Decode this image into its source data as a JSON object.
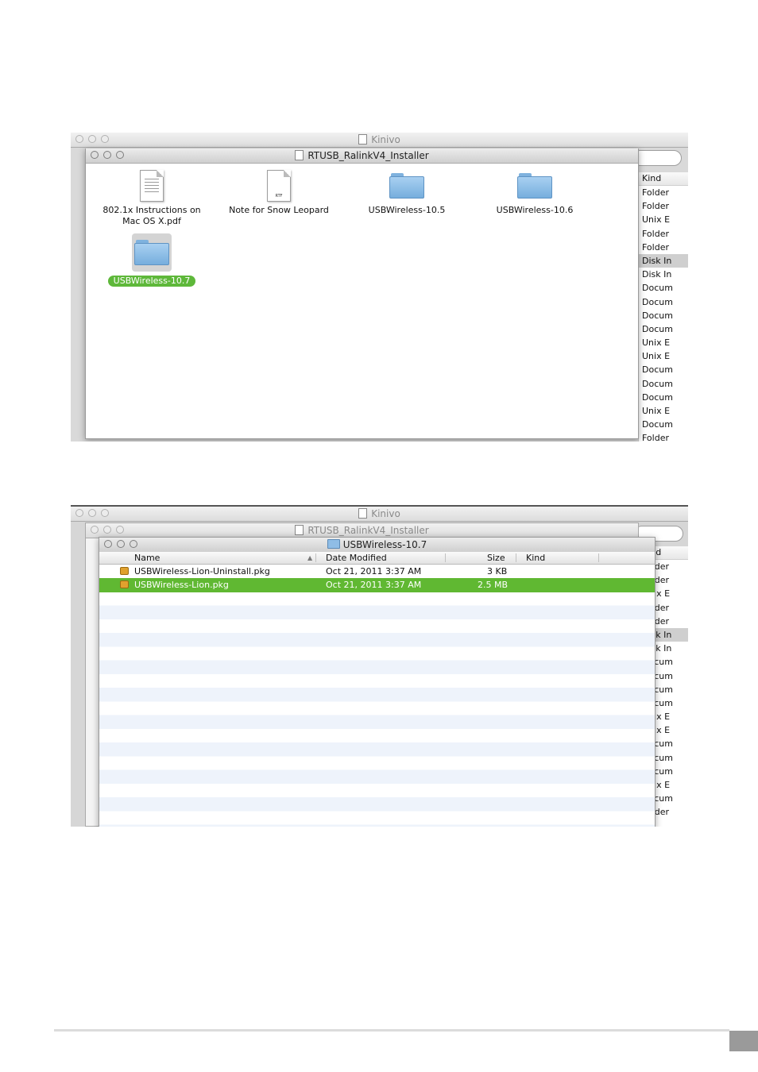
{
  "screenshot1": {
    "back_window_title": "Kinivo",
    "front_window_title": "RTUSB_RalinkV4_Installer",
    "items": [
      {
        "label_line1": "802.1x Instructions on",
        "label_line2": "Mac OS X.pdf",
        "icon": "pdf-document-icon"
      },
      {
        "label_line1": "Note for Snow Leopard",
        "label_line2": "",
        "icon": "rtf-document-icon",
        "badge": "RTF"
      },
      {
        "label_line1": "USBWireless-10.5",
        "label_line2": "",
        "icon": "folder-icon"
      },
      {
        "label_line1": "USBWireless-10.6",
        "label_line2": "",
        "icon": "folder-icon"
      },
      {
        "label_line1": "USBWireless-10.7",
        "label_line2": "",
        "icon": "folder-icon",
        "selected": true
      }
    ],
    "kind_header": "Kind",
    "kind_cells": [
      "Folder",
      "Folder",
      "Unix E",
      "Folder",
      "Folder",
      "Disk In",
      "Disk In",
      "Docum",
      "Docum",
      "Docum",
      "Docum",
      "Unix E",
      "Unix E",
      "Docum",
      "Docum",
      "Docum",
      "Unix E",
      "Docum",
      "Folder"
    ],
    "selected_kind_index": 5
  },
  "screenshot2": {
    "back_window_title": "Kinivo",
    "middle_window_title": "RTUSB_RalinkV4_Installer",
    "front_window_title": "USBWireless-10.7",
    "columns": {
      "name": "Name",
      "date": "Date Modified",
      "size": "Size",
      "kind": "Kind"
    },
    "files": [
      {
        "name": "USBWireless-Lion-Uninstall.pkg",
        "date": "Oct 21, 2011 3:37 AM",
        "size": "3 KB",
        "kind": ""
      },
      {
        "name": "USBWireless-Lion.pkg",
        "date": "Oct 21, 2011 3:37 AM",
        "size": "2.5 MB",
        "kind": "",
        "selected": true
      }
    ],
    "kind_header": "Kind",
    "kind_cells": [
      "Folder",
      "Folder",
      "Unix E",
      "Folder",
      "Folder",
      "Disk In",
      "Disk In",
      "Docum",
      "Docum",
      "Docum",
      "Docum",
      "Unix E",
      "Unix E",
      "Docum",
      "Docum",
      "Docum",
      "Unix E",
      "Docum",
      "Folder"
    ],
    "selected_kind_index": 5
  },
  "colors": {
    "selection_green": "#5eb83a",
    "folder_blue": "#8fbde6"
  }
}
